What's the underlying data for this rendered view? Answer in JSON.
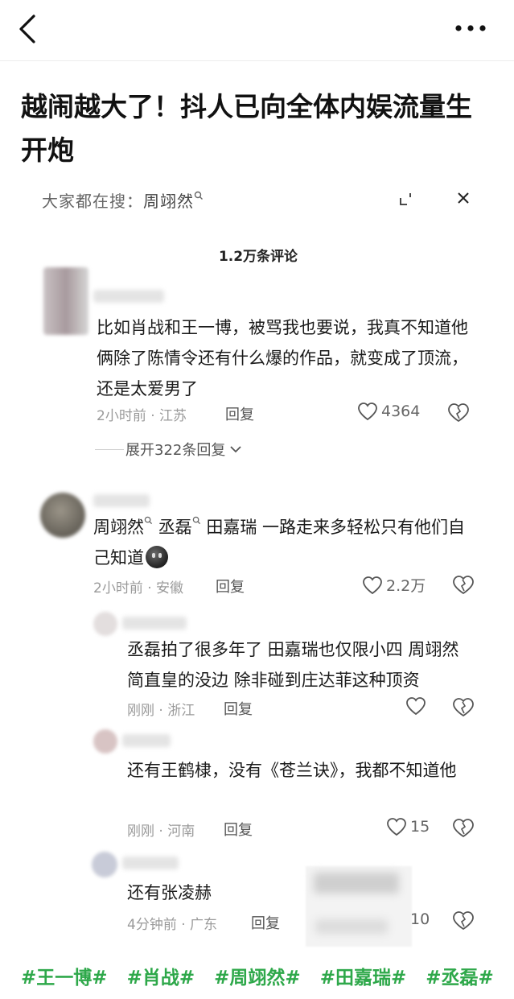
{
  "header": {
    "back_icon": "chevron-left-icon",
    "more_icon": "more-horizontal-icon"
  },
  "article": {
    "title": "越闹越大了！抖人已向全体内娱流量生开炮"
  },
  "screenshot": {
    "search_hint": "大家都在搜：",
    "search_term": "周翊然",
    "comment_count": "1.2万条评论",
    "comments": [
      {
        "text": "比如肖战和王一博，被骂我也要说，我真不知道他俩除了陈情令还有什么爆的作品，就变成了顶流，还是太爱男了",
        "meta": "2小时前 · 江苏",
        "reply_label": "回复",
        "likes": "4364",
        "expand_label": "展开322条回复"
      },
      {
        "mention1": "周翊然",
        "mention2": "丞磊",
        "text": "田嘉瑞 一路走来多轻松只有他们自己知道",
        "meta": "2小时前 · 安徽",
        "reply_label": "回复",
        "likes": "2.2万"
      }
    ],
    "replies": [
      {
        "text": "丞磊拍了很多年了 田嘉瑞也仅限小四 周翊然简直皇的没边 除非碰到庄达菲这种顶资",
        "meta": "刚刚 · 浙江",
        "reply_label": "回复",
        "likes": ""
      },
      {
        "text": "还有王鹤棣，没有《苍兰诀》，我都不知道他",
        "meta": "刚刚 · 河南",
        "reply_label": "回复",
        "likes": "15"
      },
      {
        "text": "还有张凌赫",
        "meta": "4分钟前 · 广东",
        "reply_label": "回复",
        "likes": "10"
      }
    ]
  },
  "hashtags": [
    "#王一博#",
    "#肖战#",
    "#周翊然#",
    "#田嘉瑞#",
    "#丞磊#"
  ],
  "colors": {
    "hashtag": "#2ea84a",
    "meta_text": "#9a9a9a"
  }
}
